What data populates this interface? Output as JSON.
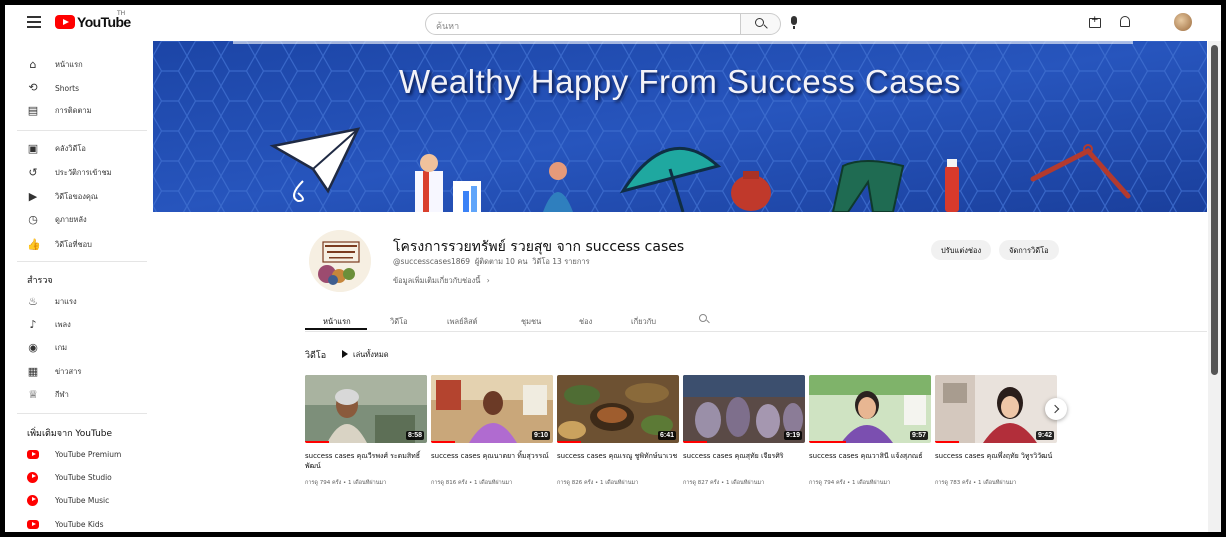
{
  "header": {
    "logo_text": "YouTube",
    "country_code": "TH",
    "search_placeholder": "ค้นหา"
  },
  "sidebar": {
    "main": [
      {
        "label": "หน้าแรก",
        "icon": "home-icon"
      },
      {
        "label": "Shorts",
        "icon": "shorts-icon"
      },
      {
        "label": "การติดตาม",
        "icon": "subscriptions-icon"
      }
    ],
    "you": [
      {
        "label": "คลังวิดีโอ",
        "icon": "library-icon"
      },
      {
        "label": "ประวัติการเข้าชม",
        "icon": "history-icon"
      },
      {
        "label": "วิดีโอของคุณ",
        "icon": "your-videos-icon"
      },
      {
        "label": "ดูภายหลัง",
        "icon": "watch-later-icon"
      },
      {
        "label": "วิดีโอที่ชอบ",
        "icon": "liked-icon"
      }
    ],
    "explore_title": "สำรวจ",
    "explore": [
      {
        "label": "มาแรง",
        "icon": "trending-icon"
      },
      {
        "label": "เพลง",
        "icon": "music-icon"
      },
      {
        "label": "เกม",
        "icon": "gaming-icon"
      },
      {
        "label": "ข่าวสาร",
        "icon": "news-icon"
      },
      {
        "label": "กีฬา",
        "icon": "sports-icon"
      }
    ],
    "more_title": "เพิ่มเติมจาก YouTube",
    "more": [
      {
        "label": "YouTube Premium",
        "color": "#ff0000"
      },
      {
        "label": "YouTube Studio",
        "color": "#ff0000"
      },
      {
        "label": "YouTube Music",
        "color": "#ff0000"
      },
      {
        "label": "YouTube Kids",
        "color": "#ff0000"
      }
    ]
  },
  "banner": {
    "title": "Wealthy Happy From Success Cases"
  },
  "channel": {
    "avatar_text": "รวยทรัพย์ รวยสุข",
    "name": "โครงการรวยทรัพย์ รวยสุข จาก success cases",
    "handle": "@successcases1869",
    "subscribers": "ผู้ติดตาม 10 คน",
    "video_count": "วิดีโอ 13 รายการ",
    "more_info": "ข้อมูลเพิ่มเติมเกี่ยวกับช่องนี้",
    "customize_label": "ปรับแต่งช่อง",
    "manage_label": "จัดการวิดีโอ"
  },
  "tabs": [
    "หน้าแรก",
    "วิดีโอ",
    "เพลย์ลิสต์",
    "ชุมชน",
    "ช่อง",
    "เกี่ยวกับ"
  ],
  "shelf": {
    "title": "วิดีโอ",
    "play_all": "เล่นทั้งหมด"
  },
  "videos": [
    {
      "title": "success cases คุณวีรพงศ์ ระดมสิทธิ์พัฒน์",
      "duration": "8:58",
      "views": "การดู 794 ครั้ง",
      "age": "1 เดือนที่ผ่านมา",
      "progress": 0.2
    },
    {
      "title": "success cases คุณนาตยา ทิ้มสุวรรณ์",
      "duration": "9:10",
      "views": "การดู 816 ครั้ง",
      "age": "1 เดือนที่ผ่านมา",
      "progress": 0.2
    },
    {
      "title": "success cases คุณเรณู ชูพิทักษ์นาเวช",
      "duration": "6:41",
      "views": "การดู 826 ครั้ง",
      "age": "1 เดือนที่ผ่านมา",
      "progress": 0.2
    },
    {
      "title": "success cases คุณสุทัย เจียรศิริ",
      "duration": "9:19",
      "views": "การดู 827 ครั้ง",
      "age": "1 เดือนที่ผ่านมา",
      "progress": 0.2
    },
    {
      "title": "success cases คุณวาสินี แจ้งสุภณธ์",
      "duration": "9:57",
      "views": "การดู 794 ครั้ง",
      "age": "1 เดือนที่ผ่านมา",
      "progress": 0.3
    },
    {
      "title": "success cases คุณพึ่งฤทัย วิทูรวิวัฒน์",
      "duration": "9:42",
      "views": "การดู 783 ครั้ง",
      "age": "1 เดือนที่ผ่านมา",
      "progress": 0.2
    }
  ]
}
